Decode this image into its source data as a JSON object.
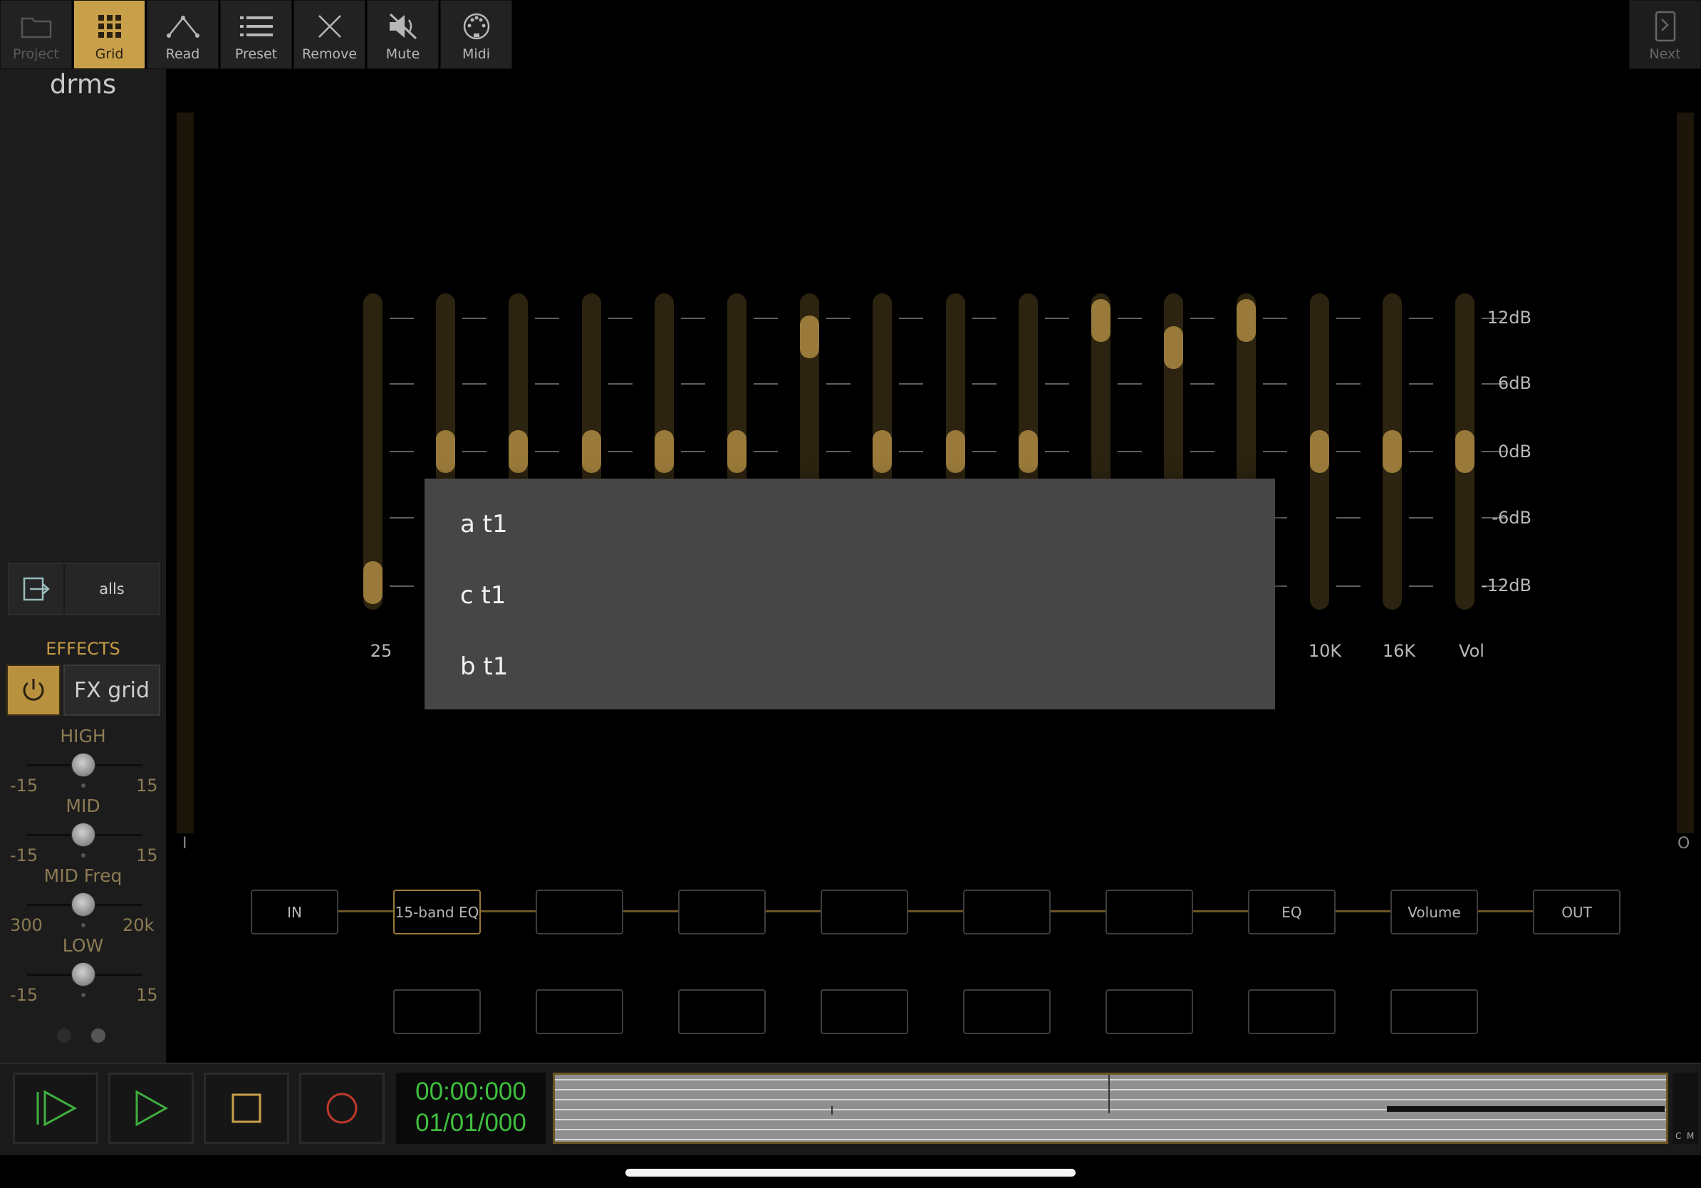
{
  "toolbar": {
    "buttons": [
      {
        "label": "Project",
        "icon": "folder-icon",
        "state": "dim"
      },
      {
        "label": "Grid",
        "icon": "grid-icon",
        "state": "active"
      },
      {
        "label": "Read",
        "icon": "curve-icon",
        "state": "normal"
      },
      {
        "label": "Preset",
        "icon": "list-icon",
        "state": "normal"
      },
      {
        "label": "Remove",
        "icon": "close-icon",
        "state": "normal"
      },
      {
        "label": "Mute",
        "icon": "mute-icon",
        "state": "normal"
      },
      {
        "label": "Midi",
        "icon": "midi-icon",
        "state": "normal"
      }
    ],
    "next_label": "Next"
  },
  "left_panel": {
    "track_name": "drms",
    "route_label": "alls",
    "effects_title": "EFFECTS",
    "fx_grid_label": "FX grid",
    "knobs": [
      {
        "title": "HIGH",
        "min": "-15",
        "max": "15",
        "value": 0.5
      },
      {
        "title": "MID",
        "min": "-15",
        "max": "15",
        "value": 0.5
      },
      {
        "title": "MID Freq",
        "min": "300",
        "max": "20k",
        "value": 0.5
      },
      {
        "title": "LOW",
        "min": "-15",
        "max": "15",
        "value": 0.5
      }
    ]
  },
  "eq": {
    "db_labels": [
      "12dB",
      "6dB",
      "0dB",
      "-6dB",
      "-12dB"
    ],
    "band_levels_db": [
      -12,
      0,
      0,
      0,
      0,
      0,
      10.5,
      0,
      0,
      0,
      12,
      9.5,
      12,
      0,
      0,
      0
    ],
    "visible_freq_labels": {
      "first": "25",
      "b14": "10K",
      "b15": "16K",
      "vol": "Vol"
    },
    "input_meter_label": "I",
    "output_meter_label": "O"
  },
  "popup": {
    "items": [
      "a t1",
      "c t1",
      "b t1"
    ]
  },
  "chain": {
    "row1": [
      "IN",
      "15-band EQ",
      "",
      "",
      "",
      "",
      "",
      "EQ",
      "Volume",
      "OUT"
    ],
    "row2": [
      "",
      "",
      "",
      "",
      "",
      "",
      "",
      ""
    ]
  },
  "transport": {
    "time": "00:00:000",
    "position": "01/01/000",
    "meter_labels": [
      "C",
      "M"
    ]
  },
  "colors": {
    "accent": "#c9a04a",
    "fader": "#9a7a3a",
    "lcd_text": "#3fbf3f",
    "record": "#c0392b"
  }
}
